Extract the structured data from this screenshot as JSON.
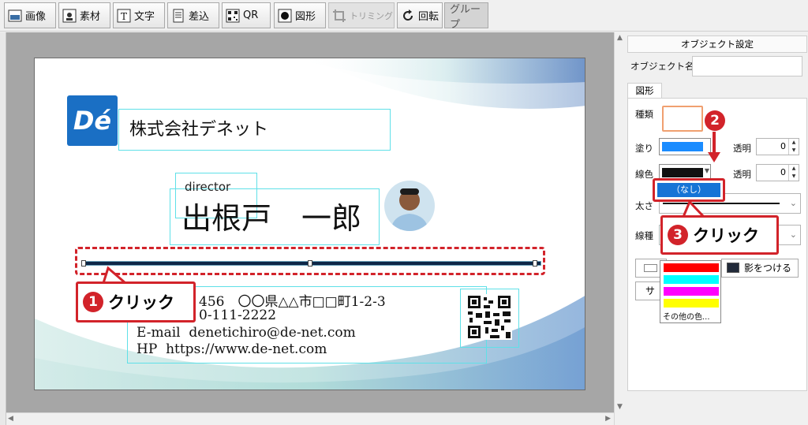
{
  "toolbar": {
    "items": [
      {
        "label": "画像",
        "icon": "image-icon"
      },
      {
        "label": "素材",
        "icon": "material-icon"
      },
      {
        "label": "文字",
        "icon": "text-icon"
      },
      {
        "label": "差込",
        "icon": "merge-icon"
      },
      {
        "label": "QR",
        "icon": "qr-icon"
      },
      {
        "label": "図形",
        "icon": "shape-icon"
      },
      {
        "label": "トリミング",
        "icon": "crop-icon"
      },
      {
        "label": "回転",
        "icon": "rotate-icon"
      },
      {
        "label": "グループ",
        "icon": ""
      }
    ]
  },
  "card": {
    "logo_text": "Dé",
    "company": "株式会社デネット",
    "title": "director",
    "name": "出根戸　一郎",
    "address_line": "456　〇〇県△△市□□町1-2-3",
    "tel_line": "0-111-2222",
    "email_line": "E-mail  denetichiro@de-net.com",
    "hp_line": "HP  https://www.de-net.com"
  },
  "panel": {
    "title": "オブジェクト設定",
    "object_name_label": "オブジェクト名",
    "object_name_value": "",
    "tab_shape": "図形",
    "kind_label": "種類",
    "fill_label": "塗り",
    "fill_color": "#1a8cff",
    "fill_transparency_label": "透明",
    "fill_transparency_value": "0",
    "line_color_label": "線色",
    "line_color": "#111111",
    "line_transparency_label": "透明",
    "line_transparency_value": "0",
    "thickness_label": "太さ",
    "line_type_label": "線種",
    "shadow_button": "影をつける",
    "size_button": "サイ"
  },
  "color_dropdown": {
    "none_label": "（なし）",
    "colors": [
      "#ff0000",
      "#00ffff",
      "#ff00ff",
      "#ffff00"
    ],
    "other_label": "その他の色..."
  },
  "callouts": {
    "step1_num": "❶",
    "step1_label": "クリック",
    "step2_num": "❷",
    "step3_num": "❸",
    "step3_label": "クリック"
  },
  "colors": {
    "accent_red": "#d2232a",
    "selection_cyan": "#5fe0e8",
    "logo_blue": "#1a6fc4"
  }
}
